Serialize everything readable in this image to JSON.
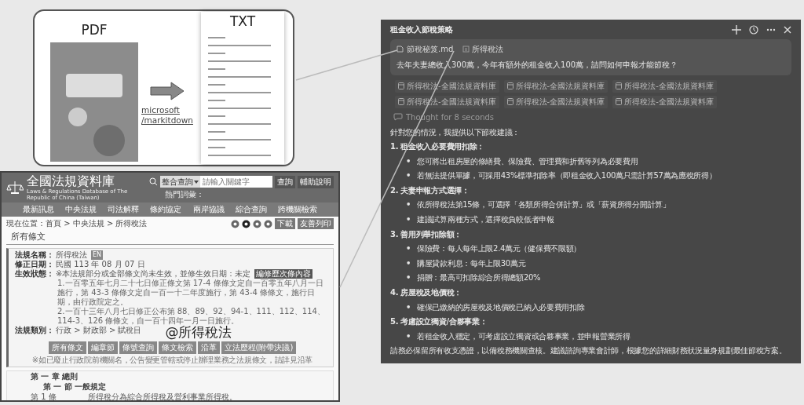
{
  "conversion": {
    "source_label": "PDF",
    "target_label": "TXT",
    "tool_link": [
      "microsoft",
      "/markitdown"
    ]
  },
  "law_site": {
    "title": "全國法規資料庫",
    "subtitle": "Laws & Regulations Database of The Republic of China (Taiwan)",
    "search_scope": "整合查詢",
    "search_placeholder": "請輸入關鍵字",
    "search_buttons": [
      "查詢",
      "輔助說明"
    ],
    "hot_words_label": "熱門詞彙：",
    "nav": [
      "最新訊息",
      "中央法規",
      "司法解釋",
      "條約協定",
      "兩岸協議",
      "綜合查詢",
      "跨機關檢索"
    ],
    "breadcrumb": "現在位置：首頁 > 中央法規 > 所得稅法",
    "actions": [
      "下載",
      "友善列印"
    ],
    "section_title": "所有條文",
    "fields": [
      {
        "kind": "name",
        "label": "法規名稱：",
        "value": "所得稅法",
        "badge": "EN"
      },
      {
        "kind": "text",
        "label": "修正日期：",
        "value": "民國 113 年 08 月 07 日"
      },
      {
        "kind": "status",
        "label": "生效狀態：",
        "value": "※本法規部分或全部條文尚未生效，並修生效日期：未定",
        "tag": "編修歷次條內容",
        "notes": [
          "1.一百零五年七月二十七日修正條文第 17-4 條條文定自一百零五年八月一日施行，第 43-3 條條文定自一百一十二年度施行，第 43-4 條條文，施行日期，由行政院定之。",
          "2.一百十三年八月七日修正公布第 88、89、92、94-1、111、112、114、114-3、126 條條文，自一百十四年一月一日施行。"
        ]
      },
      {
        "kind": "category",
        "label": "法規類別：",
        "value": "行政 > 財政部 > 賦稅目"
      }
    ],
    "mention_overlay": "@所得稅法",
    "tabs": [
      "所有條文",
      "編章節",
      "條號查詢",
      "條文檢索",
      "沿革",
      "立法歷程(附帶決議)"
    ],
    "note": "※如已廢止行政院前機關名，公告變更管轄或停止辦理業務之法規條文，請詳見沿革",
    "outline": [
      {
        "kind": "chapter",
        "text": "第 一 章 總則"
      },
      {
        "kind": "section",
        "text": "第 一 節 一般規定"
      },
      {
        "kind": "article",
        "number": "第 1 條",
        "text": "所得稅分為綜合所得稅及營利事業所得稅。"
      }
    ]
  },
  "chat": {
    "title": "租金收入節稅策略",
    "attachments": [
      {
        "kind": "file",
        "label": "節稅秘笈.md"
      },
      {
        "kind": "doc",
        "label": "所得稅法"
      }
    ],
    "question": "去年夫妻總收入300萬，今年有額外的租金收入100萬，請問如何申報才能節稅？",
    "sources": [
      "所得稅法-全國法規資料庫",
      "所得稅法-全國法規資料庫",
      "所得稅法-全國法規資料庫",
      "所得稅法-全國法規資料庫",
      "所得稅法-全國法規資料庫",
      "所得稅法-全國法規資料庫"
    ],
    "thought": "Thought for 8 seconds",
    "bullet_marker": "•",
    "intro": "針對您的情況，我提供以下節稅建議：",
    "sections": [
      {
        "heading": "1. 租金收入必要費用扣除：",
        "bullets": [
          "您可將出租房屋的修繕費、保險費、管理費和折舊等列為必要費用",
          "若無法提供單據，可採用43%標準扣除率（即租金收入100萬只需計算57萬為應稅所得）"
        ]
      },
      {
        "heading": "2. 夫妻申報方式選擇：",
        "bullets": [
          "依所得稅法第15條，可選擇「各類所得合併計算」或「薪資所得分開計算」",
          "建議試算兩種方式，選擇稅負較低者申報"
        ]
      },
      {
        "heading": "3. 善用列舉扣除額：",
        "bullets": [
          "保險費：每人每年上限2.4萬元（健保費不限額）",
          "購屋貸款利息：每年上限30萬元",
          "捐贈：最高可扣除綜合所得總額20%"
        ]
      },
      {
        "heading": "4. 房屋稅及地價稅：",
        "bullets": [
          "確保已繳納的房屋稅及地價稅已納入必要費用扣除"
        ]
      },
      {
        "heading": "5. 考慮設立獨資/合夥事業：",
        "bullets": [
          "若租金收入穩定，可考慮設立獨資或合夥事業，並申報營業所得"
        ]
      }
    ],
    "closing": "請務必保留所有收支憑證，以備稅務機關查核。建議諮詢專業會計師，根據您的詳細財務狀況量身規劃最佳節稅方案。"
  }
}
